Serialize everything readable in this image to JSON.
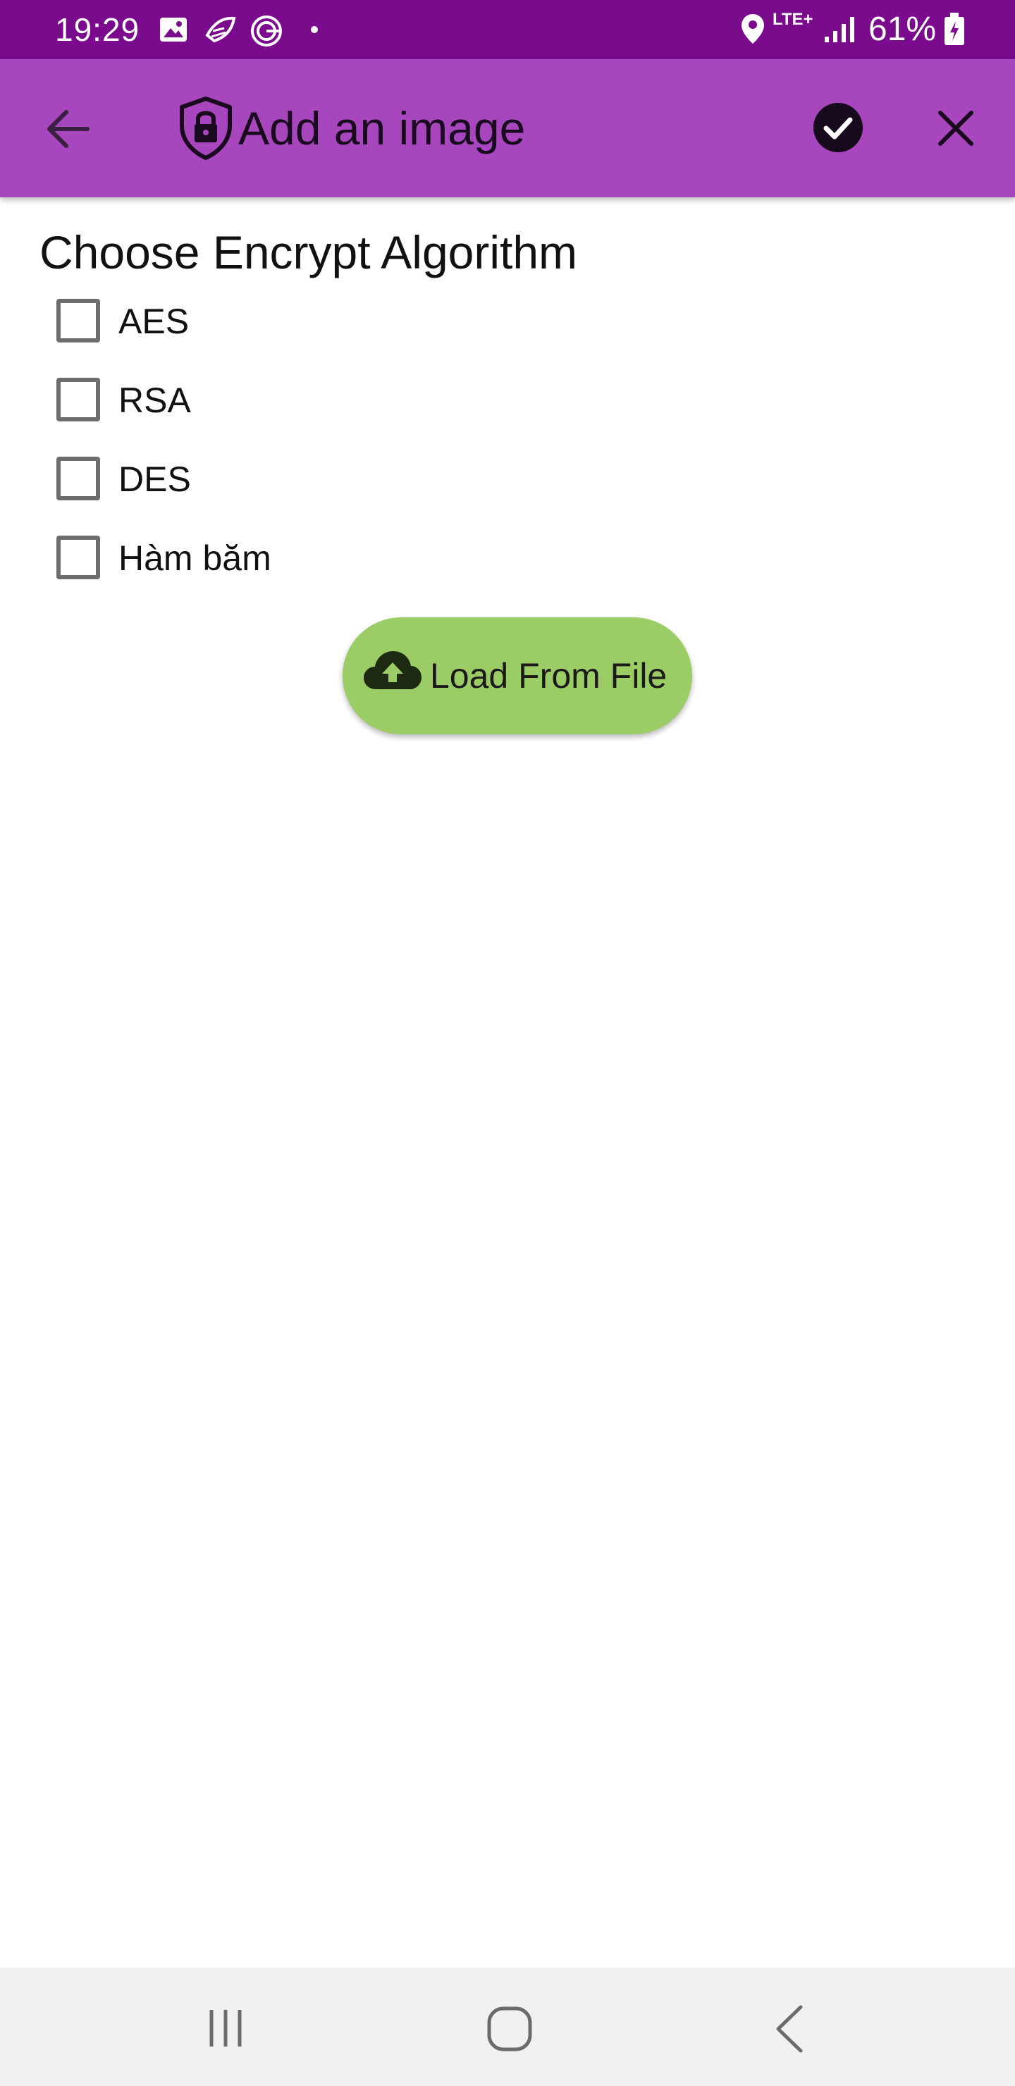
{
  "status_bar": {
    "time": "19:29",
    "network": "LTE+",
    "battery": "61%",
    "icons": [
      "image-icon",
      "rocket-icon",
      "g-app-icon",
      "dot-icon",
      "location-icon",
      "signal-icon",
      "battery-icon"
    ]
  },
  "app_bar": {
    "title": "Add an image",
    "icons": [
      "back-arrow-icon",
      "shield-lock-icon",
      "check-circle-icon",
      "close-icon"
    ]
  },
  "form": {
    "heading": "Choose Encrypt Algorithm",
    "options": [
      {
        "label": "AES",
        "checked": false
      },
      {
        "label": "RSA",
        "checked": false
      },
      {
        "label": "DES",
        "checked": false
      },
      {
        "label": "Hàm băm",
        "checked": false
      }
    ],
    "load_button_label": "Load From File"
  },
  "nav_bar": {
    "icons": [
      "recents-icon",
      "home-icon",
      "back-icon"
    ]
  },
  "colors": {
    "status_bar": "#790b8c",
    "app_bar": "#a846bd",
    "load_button": "#9ccc65",
    "nav_bar": "#f1f1f1"
  }
}
